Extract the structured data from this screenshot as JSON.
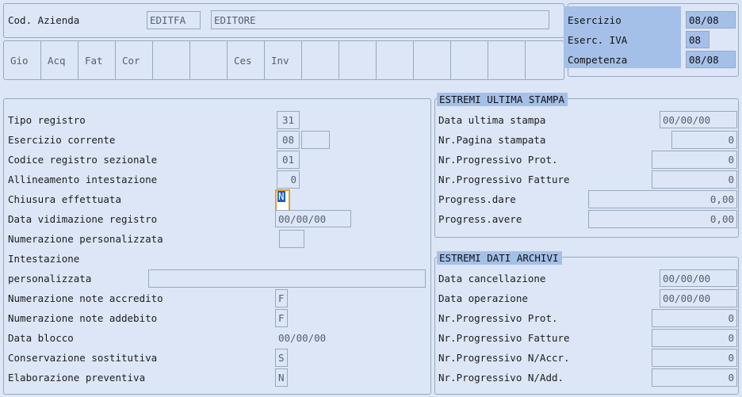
{
  "header": {
    "company_label": "Cod. Azienda",
    "company_code": "EDITFA",
    "company_name": "EDITORE"
  },
  "tabs": [
    {
      "label": "Gio"
    },
    {
      "label": "Acq"
    },
    {
      "label": "Fat"
    },
    {
      "label": "Cor"
    },
    {
      "label": ""
    },
    {
      "label": ""
    },
    {
      "label": "Ces"
    },
    {
      "label": "Inv"
    },
    {
      "label": ""
    },
    {
      "label": ""
    },
    {
      "label": ""
    },
    {
      "label": ""
    },
    {
      "label": ""
    },
    {
      "label": ""
    },
    {
      "label": ""
    }
  ],
  "exercise_panel": {
    "esercizio_label": "Esercizio",
    "esercizio_value": "08/08",
    "eserc_iva_label": "Eserc. IVA",
    "eserc_iva_value": "08",
    "competenza_label": "Competenza",
    "competenza_value": "08/08"
  },
  "left_form": {
    "tipo_registro_label": "Tipo registro",
    "tipo_registro_value": "31",
    "esercizio_corrente_label": "Esercizio corrente",
    "esercizio_corrente_value": "08",
    "esercizio_corrente_value2": "",
    "codice_registro_label": "Codice registro sezionale",
    "codice_registro_value": "01",
    "allineamento_label": "Allineamento intestazione",
    "allineamento_value": "0",
    "chiusura_label": "Chiusura effettuata",
    "chiusura_value": "N",
    "data_vidimazione_label": "Data vidimazione registro",
    "data_vidimazione_value": "00/00/00",
    "numerazione_pers_label": "Numerazione personalizzata",
    "numerazione_pers_value": "",
    "intestazione_label": "Intestazione",
    "personalizzata_label": "personalizzata",
    "personalizzata_value": "",
    "note_accredito_label": "Numerazione note accredito",
    "note_accredito_value": "F",
    "note_addebito_label": "Numerazione note addebito",
    "note_addebito_value": "F",
    "data_blocco_label": "Data blocco",
    "data_blocco_value": "00/00/00",
    "conservazione_label": "Conservazione sostitutiva",
    "conservazione_value": "S",
    "elaborazione_label": "Elaborazione preventiva",
    "elaborazione_value": "N"
  },
  "ultima_stampa": {
    "caption": "ESTREMI ULTIMA STAMPA",
    "data_ultima_stampa_label": "Data ultima stampa",
    "data_ultima_stampa_value": "00/00/00",
    "nr_pagina_label": "Nr.Pagina stampata",
    "nr_pagina_value": "0",
    "nr_prog_prot_label": "Nr.Progressivo Prot.",
    "nr_prog_prot_value": "0",
    "nr_prog_fatture_label": "Nr.Progressivo Fatture",
    "nr_prog_fatture_value": "0",
    "progress_dare_label": "Progress.dare",
    "progress_dare_value": "0,00",
    "progress_avere_label": "Progress.avere",
    "progress_avere_value": "0,00"
  },
  "dati_archivi": {
    "caption": "ESTREMI DATI ARCHIVI",
    "data_cancellazione_label": "Data cancellazione",
    "data_cancellazione_value": "00/00/00",
    "data_operazione_label": "Data operazione",
    "data_operazione_value": "00/00/00",
    "nr_prog_prot_label": "Nr.Progressivo Prot.",
    "nr_prog_prot_value": "0",
    "nr_prog_fatture_label": "Nr.Progressivo Fatture",
    "nr_prog_fatture_value": "0",
    "nr_prog_naccr_label": "Nr.Progressivo N/Accr.",
    "nr_prog_naccr_value": "0",
    "nr_prog_nadd_label": "Nr.Progressivo N/Add.",
    "nr_prog_nadd_value": "0"
  },
  "colors": {
    "background": "#dce6f7",
    "border": "#9aa7bd",
    "caption_blue": "#a5c0e8",
    "focus_gold": "#e0a12c",
    "selection_blue": "#1d5fbf",
    "field_text": "#555f6d"
  }
}
